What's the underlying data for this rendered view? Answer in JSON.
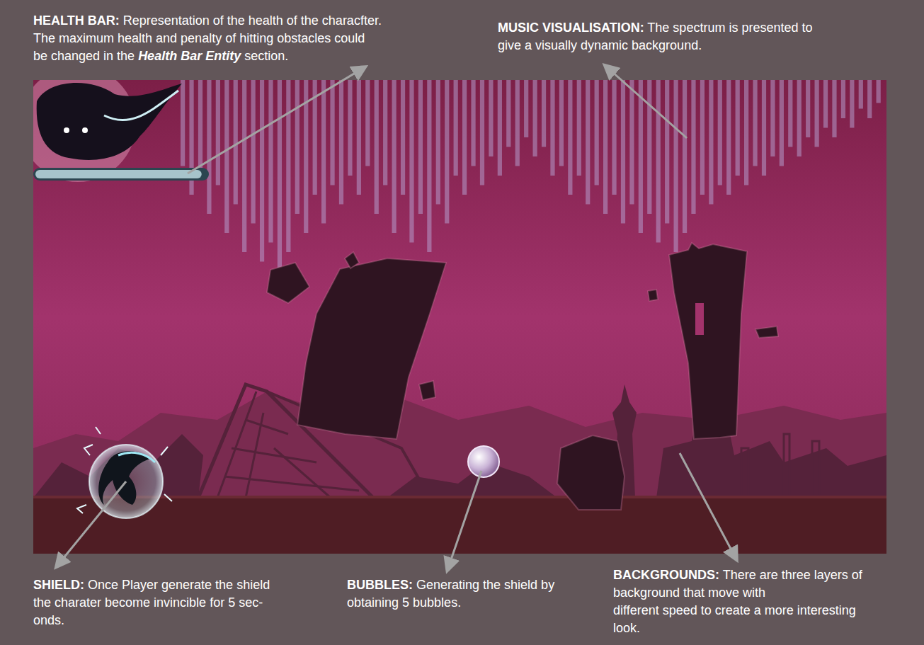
{
  "annotations": {
    "health_bar": {
      "lines": [
        [
          {
            "text": "HEALTH BAR:",
            "kind": "title"
          },
          {
            "text": " Representation of the health of the characfter.",
            "kind": "plain"
          }
        ],
        [
          {
            "text": "The maximum health and penalty of hitting obstacles could",
            "kind": "plain"
          }
        ],
        [
          {
            "text": "be changed in the ",
            "kind": "plain"
          },
          {
            "text": "Health Bar Entity",
            "kind": "emphasis"
          },
          {
            "text": " section.",
            "kind": "plain"
          }
        ]
      ]
    },
    "music_visualisation": {
      "lines": [
        [
          {
            "text": "MUSIC VISUALISATION:",
            "kind": "title"
          },
          {
            "text": " The spectrum is presented to",
            "kind": "plain"
          }
        ],
        [
          {
            "text": "give a visually dynamic background.",
            "kind": "plain"
          }
        ]
      ]
    },
    "shield": {
      "lines": [
        [
          {
            "text": "SHIELD:",
            "kind": "title"
          },
          {
            "text": " Once Player generate the shield",
            "kind": "plain"
          }
        ],
        [
          {
            "text": "the charater become invincible for 5 sec-",
            "kind": "plain"
          }
        ],
        [
          {
            "text": "onds.",
            "kind": "plain"
          }
        ]
      ]
    },
    "bubbles": {
      "lines": [
        [
          {
            "text": "BUBBLES:",
            "kind": "title"
          },
          {
            "text": " Generating the shield by",
            "kind": "plain"
          }
        ],
        [
          {
            "text": "obtaining 5 bubbles.",
            "kind": "plain"
          }
        ]
      ]
    },
    "backgrounds": {
      "lines": [
        [
          {
            "text": "BACKGROUNDS:",
            "kind": "title"
          },
          {
            "text": " There are three layers of",
            "kind": "plain"
          }
        ],
        [
          {
            "text": "background that move with",
            "kind": "plain"
          }
        ],
        [
          {
            "text": "different speed to create a more interesting",
            "kind": "plain"
          }
        ],
        [
          {
            "text": "look.",
            "kind": "plain"
          }
        ]
      ]
    }
  },
  "game": {
    "health": {
      "level": 0.97
    },
    "shield": {
      "active": true
    },
    "spectrum": {
      "values": [
        0.45,
        0.6,
        0.5,
        0.7,
        0.55,
        0.8,
        0.65,
        0.9,
        0.75,
        0.95,
        0.85,
        1.0,
        0.9,
        0.7,
        0.8,
        0.6,
        0.75,
        0.55,
        0.65,
        0.5,
        0.6,
        0.45,
        0.7,
        0.55,
        0.8,
        0.6,
        0.85,
        0.7,
        0.9,
        0.65,
        0.75,
        0.5,
        0.6,
        0.45,
        0.55,
        0.4,
        0.5,
        0.35,
        0.45,
        0.3,
        0.4,
        0.35,
        0.5,
        0.45,
        0.6,
        0.5,
        0.65,
        0.55,
        0.7,
        0.6,
        0.75,
        0.65,
        0.8,
        0.7,
        0.85,
        0.75,
        0.9,
        0.8,
        0.7,
        0.6,
        0.65,
        0.55,
        0.6,
        0.5,
        0.55,
        0.45,
        0.5,
        0.4,
        0.45,
        0.35,
        0.4,
        0.3,
        0.35,
        0.25,
        0.3,
        0.2,
        0.25,
        0.15,
        0.2,
        0.12
      ]
    }
  }
}
